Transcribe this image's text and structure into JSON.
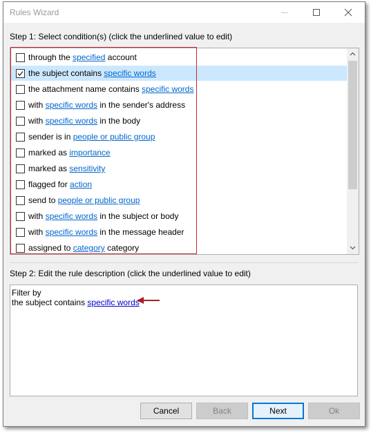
{
  "window": {
    "title": "Rules Wizard"
  },
  "step1": {
    "label": "Step 1: Select condition(s) (click the underlined value to edit)"
  },
  "conditions": [
    {
      "checked": false,
      "pre": "through the ",
      "link": "specified",
      "post": " account"
    },
    {
      "checked": true,
      "pre": "the subject contains ",
      "link": "specific words",
      "post": ""
    },
    {
      "checked": false,
      "pre": "the attachment name contains ",
      "link": "specific words",
      "post": ""
    },
    {
      "checked": false,
      "pre": "with ",
      "link": "specific words",
      "post": " in the sender's address"
    },
    {
      "checked": false,
      "pre": "with ",
      "link": "specific words",
      "post": " in the body"
    },
    {
      "checked": false,
      "pre": "sender is in ",
      "link": "people or public group",
      "post": ""
    },
    {
      "checked": false,
      "pre": "marked as ",
      "link": "importance",
      "post": ""
    },
    {
      "checked": false,
      "pre": "marked as ",
      "link": "sensitivity",
      "post": ""
    },
    {
      "checked": false,
      "pre": "flagged for ",
      "link": "action",
      "post": ""
    },
    {
      "checked": false,
      "pre": "send to ",
      "link": "people or public group",
      "post": ""
    },
    {
      "checked": false,
      "pre": "with ",
      "link": "specific words",
      "post": " in the subject or body"
    },
    {
      "checked": false,
      "pre": "with ",
      "link": "specific words",
      "post": " in the message header"
    },
    {
      "checked": false,
      "pre": "assigned to ",
      "link": "category",
      "post": " category"
    }
  ],
  "step2": {
    "label": "Step 2: Edit the rule description (click the underlined value to edit)",
    "line1": "Filter by",
    "line2_pre": "the subject contains ",
    "line2_link": "specific words"
  },
  "buttons": {
    "cancel": "Cancel",
    "back": "Back",
    "next": "Next",
    "ok": "Ok"
  },
  "colors": {
    "selection": "#cce8ff",
    "link": "#0066cc",
    "annotation": "#a81e23"
  }
}
